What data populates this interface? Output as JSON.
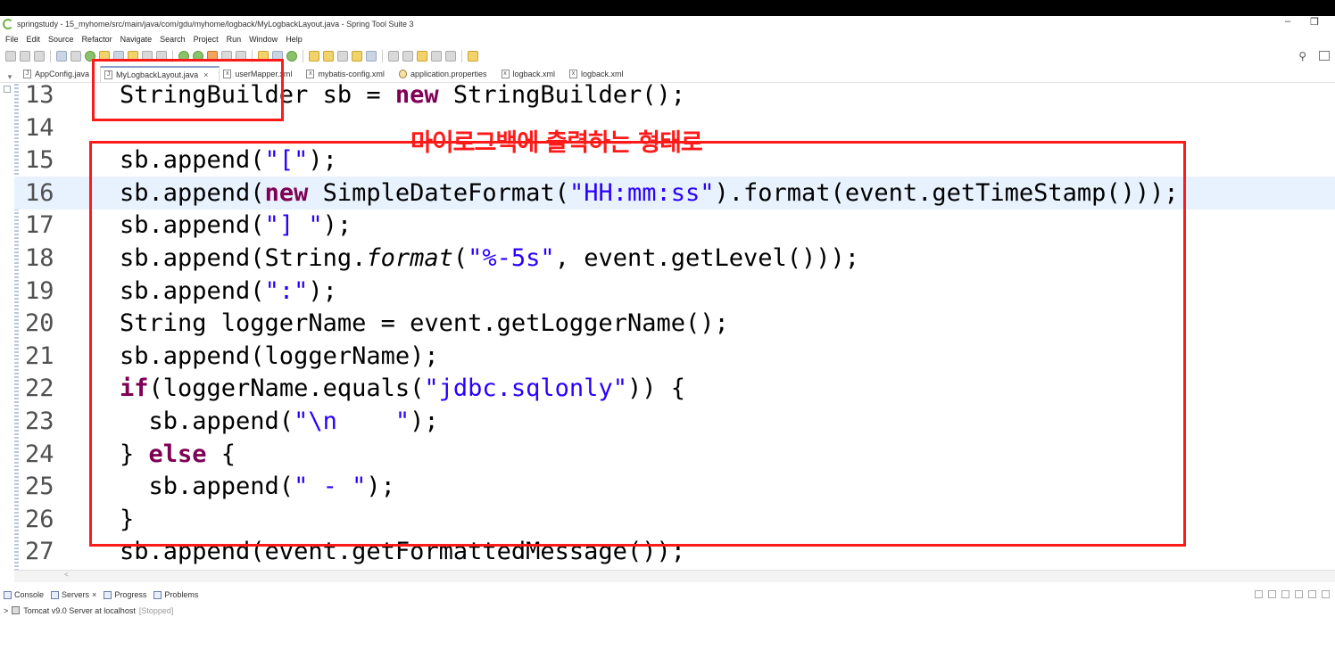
{
  "window": {
    "title": "springstudy - 15_myhome/src/main/java/com/gdu/myhome/logback/MyLogbackLayout.java - Spring Tool Suite 3",
    "minimize_glyph": "–",
    "restore_glyph": "❐"
  },
  "menu": [
    "File",
    "Edit",
    "Source",
    "Refactor",
    "Navigate",
    "Search",
    "Project",
    "Run",
    "Window",
    "Help"
  ],
  "tabs": [
    {
      "label": "AppConfig.java",
      "icon": "java-file-icon",
      "active": false
    },
    {
      "label": "MyLogbackLayout.java",
      "icon": "java-file-icon",
      "active": true,
      "close": "×"
    },
    {
      "label": "userMapper.xml",
      "icon": "xml-file-icon",
      "active": false
    },
    {
      "label": "mybatis-config.xml",
      "icon": "xml-file-icon",
      "active": false
    },
    {
      "label": "application.properties",
      "icon": "properties-file-icon",
      "active": false
    },
    {
      "label": "logback.xml",
      "icon": "xml-file-icon",
      "active": false
    },
    {
      "label": "logback.xml",
      "icon": "xml-file-icon",
      "active": false
    }
  ],
  "editor": {
    "lines": [
      {
        "n": "13",
        "parts": [
          [
            "t",
            "StringBuilder sb = "
          ],
          [
            "k",
            "new"
          ],
          [
            "t",
            " StringBuilder();"
          ]
        ]
      },
      {
        "n": "14",
        "parts": []
      },
      {
        "n": "15",
        "parts": [
          [
            "t",
            "sb.append("
          ],
          [
            "s",
            "\"[\""
          ],
          [
            "t",
            ");"
          ]
        ]
      },
      {
        "n": "16",
        "parts": [
          [
            "t",
            "sb.append("
          ],
          [
            "k",
            "new"
          ],
          [
            "t",
            " SimpleDateFormat("
          ],
          [
            "s",
            "\"HH:mm:ss\""
          ],
          [
            "t",
            ").format(event.getTimeStamp()));"
          ]
        ],
        "current": true
      },
      {
        "n": "17",
        "parts": [
          [
            "t",
            "sb.append("
          ],
          [
            "s",
            "\"] \""
          ],
          [
            "t",
            ");"
          ]
        ]
      },
      {
        "n": "18",
        "parts": [
          [
            "t",
            "sb.append(String."
          ],
          [
            "i",
            "format"
          ],
          [
            "t",
            "("
          ],
          [
            "s",
            "\"%-5s\""
          ],
          [
            "t",
            ", event.getLevel()));"
          ]
        ]
      },
      {
        "n": "19",
        "parts": [
          [
            "t",
            "sb.append("
          ],
          [
            "s",
            "\":\""
          ],
          [
            "t",
            ");"
          ]
        ]
      },
      {
        "n": "20",
        "parts": [
          [
            "t",
            "String loggerName = event.getLoggerName();"
          ]
        ]
      },
      {
        "n": "21",
        "parts": [
          [
            "t",
            "sb.append(loggerName);"
          ]
        ]
      },
      {
        "n": "22",
        "parts": [
          [
            "k",
            "if"
          ],
          [
            "t",
            "(loggerName.equals("
          ],
          [
            "s",
            "\"jdbc.sqlonly\""
          ],
          [
            "t",
            ")) {"
          ]
        ]
      },
      {
        "n": "23",
        "parts": [
          [
            "t",
            "  sb.append("
          ],
          [
            "s",
            "\"\\n    \""
          ],
          [
            "t",
            ");"
          ]
        ]
      },
      {
        "n": "24",
        "parts": [
          [
            "t",
            "} "
          ],
          [
            "k",
            "else"
          ],
          [
            "t",
            " {"
          ]
        ]
      },
      {
        "n": "25",
        "parts": [
          [
            "t",
            "  sb.append("
          ],
          [
            "s",
            "\" - \""
          ],
          [
            "t",
            ");"
          ]
        ]
      },
      {
        "n": "26",
        "parts": [
          [
            "t",
            "}"
          ]
        ]
      },
      {
        "n": "27",
        "parts": [
          [
            "t",
            "sb.append(event.getFormattedMessage());"
          ]
        ]
      }
    ],
    "colors": {
      "keyword": "#7f0055",
      "string": "#2a00ff",
      "current_line": "#e8f2fe",
      "annotation": "#ff1a1a"
    }
  },
  "annotation": {
    "text": "마이로그백에 출력하는 형태로"
  },
  "bottom_panel": {
    "tabs": [
      {
        "label": "Console",
        "icon": "console-icon"
      },
      {
        "label": "Servers",
        "icon": "servers-icon",
        "close": "×"
      },
      {
        "label": "Progress",
        "icon": "progress-icon"
      },
      {
        "label": "Problems",
        "icon": "problems-icon"
      }
    ],
    "server": {
      "expander": ">",
      "name": "Tomcat v9.0 Server at localhost",
      "status": "[Stopped]"
    }
  }
}
